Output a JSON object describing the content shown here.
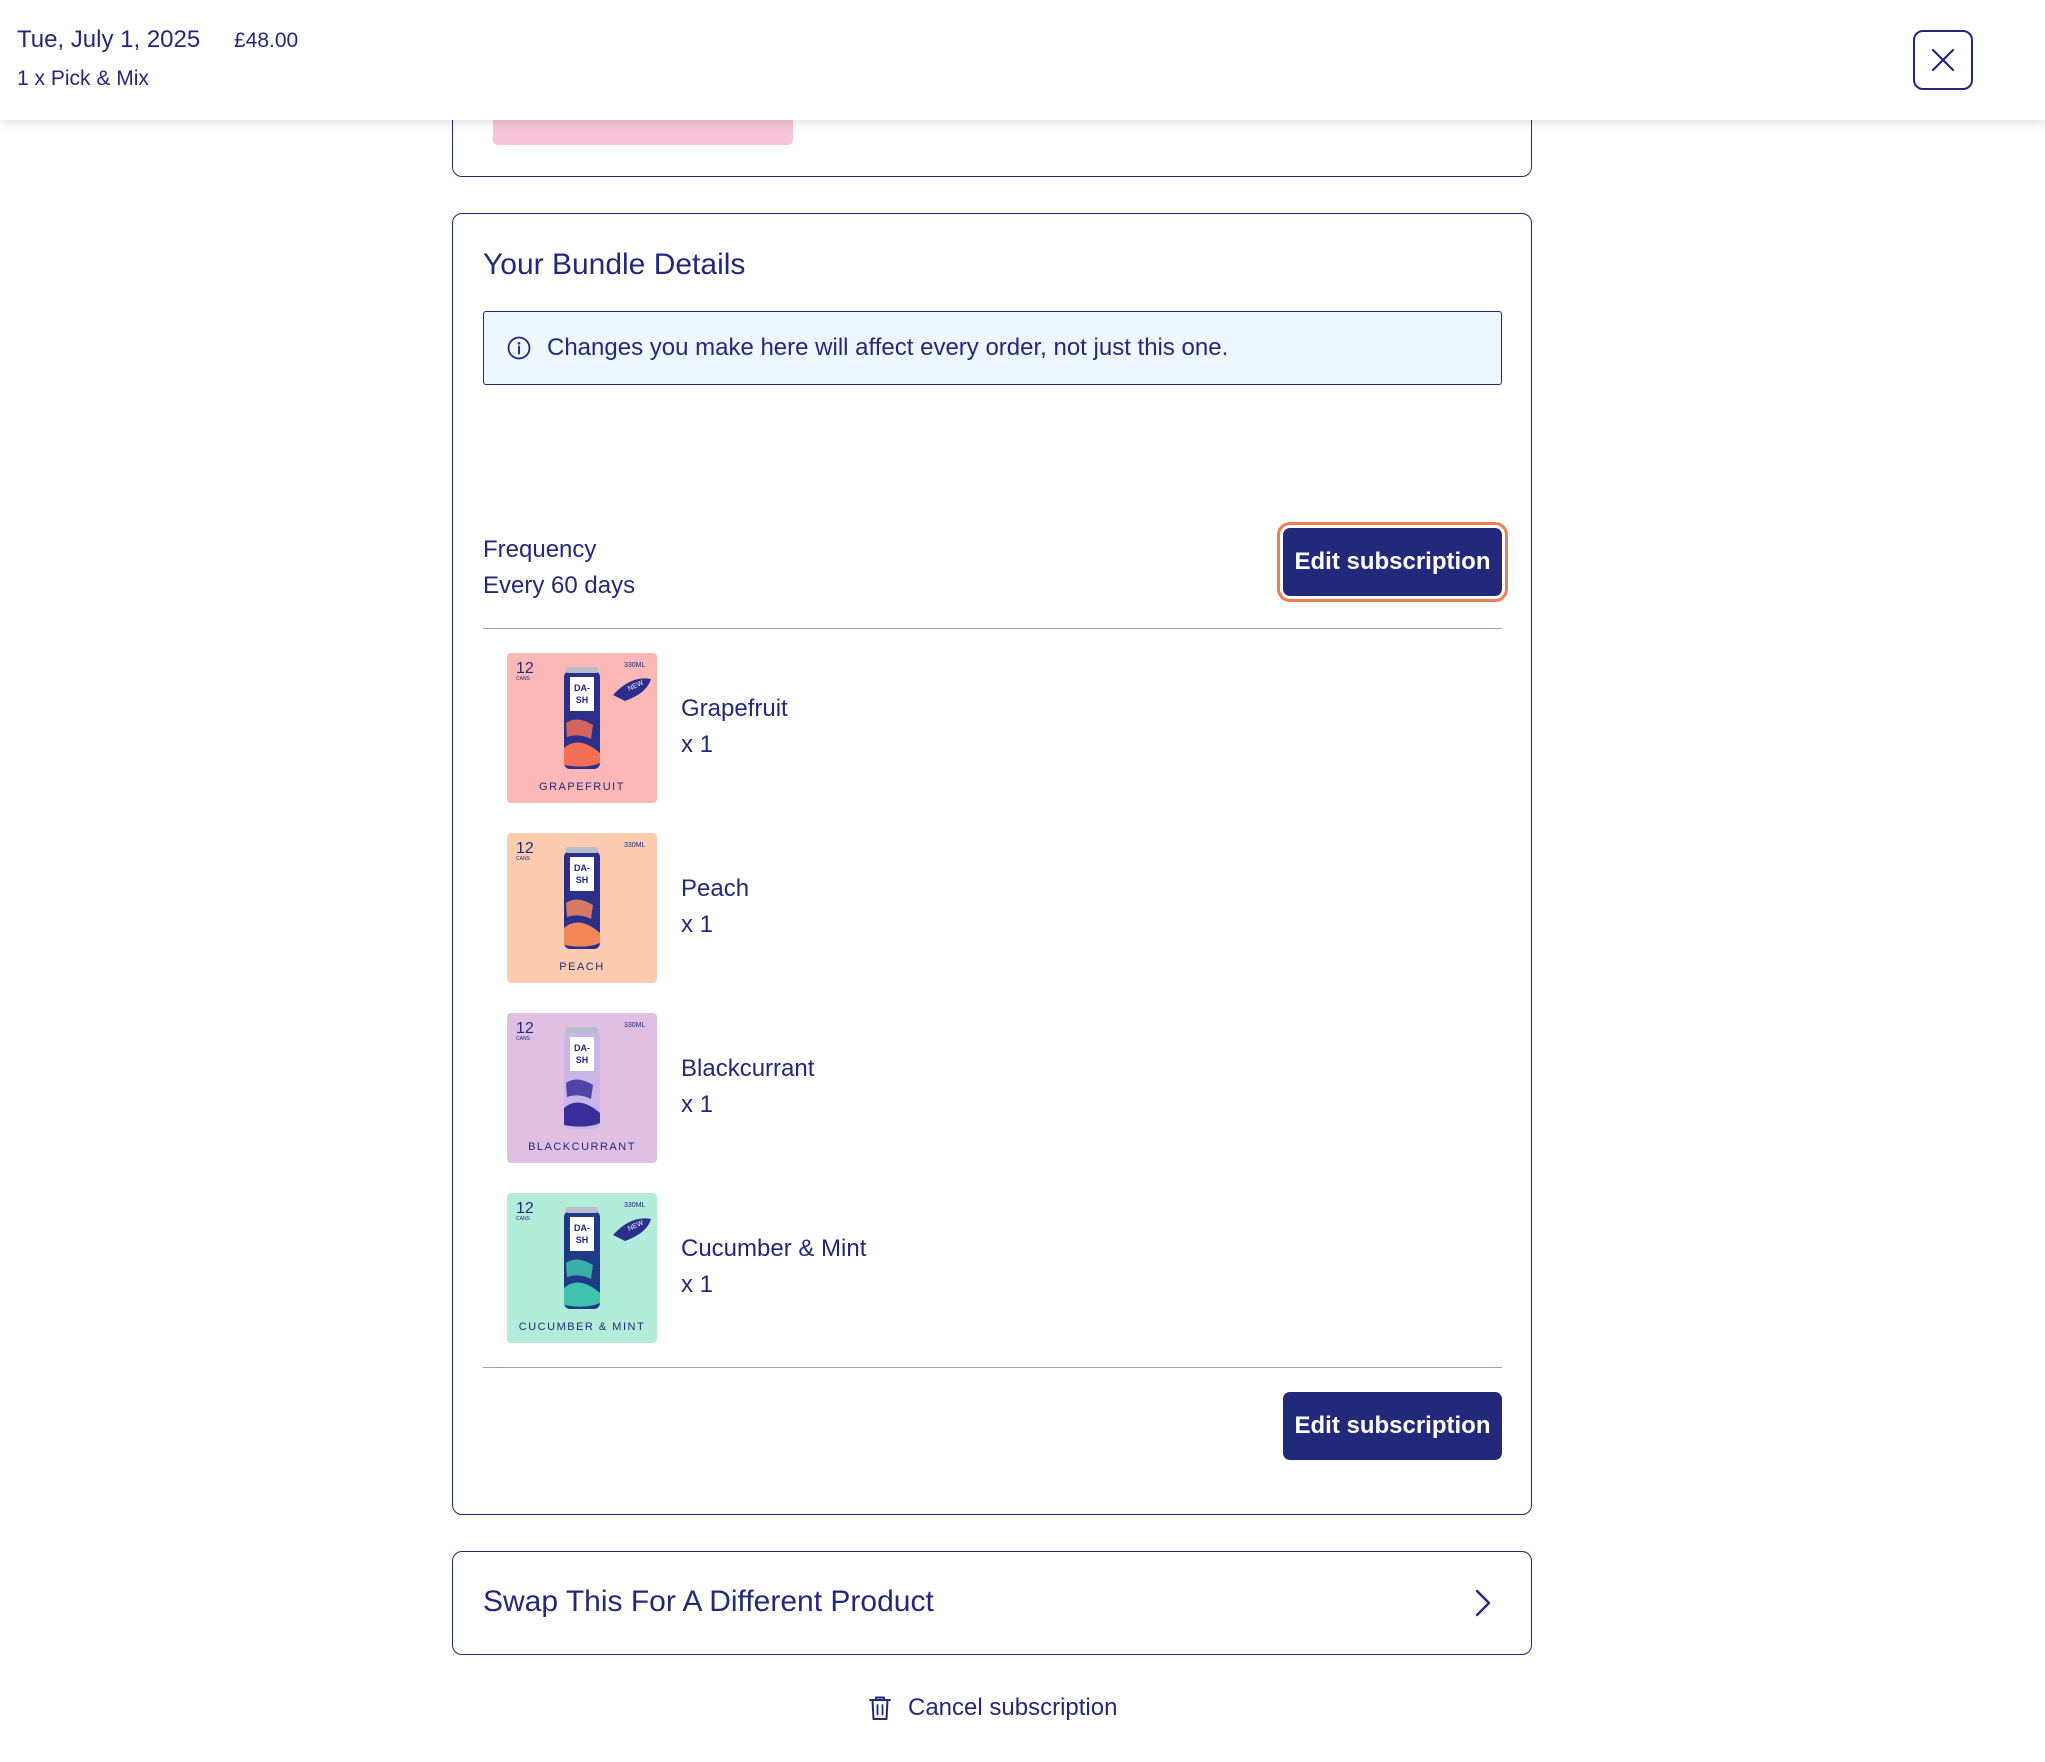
{
  "header": {
    "date": "Tue, July 1, 2025",
    "price": "£48.00",
    "items_summary": "1 x Pick & Mix",
    "close_icon": "close-icon"
  },
  "bundle": {
    "title": "Your Bundle Details",
    "info_icon": "info-icon",
    "info_text": "Changes you make here will affect every order, not just this one.",
    "frequency_label": "Frequency",
    "frequency_value": "Every 60 days",
    "edit_label_top": "Edit subscription",
    "edit_label_bottom": "Edit subscription",
    "products": [
      {
        "name": "Grapefruit",
        "qty": "x 1",
        "pack_label": "GRAPEFRUIT",
        "count": "12",
        "count_unit": "CANS",
        "volume": "330ML",
        "brand": "DA- SH",
        "new_badge": "NEW",
        "bg": "#fbb8b6",
        "can": "#2a2f8c",
        "accent": "#f26e55"
      },
      {
        "name": "Peach",
        "qty": "x 1",
        "pack_label": "PEACH",
        "count": "12",
        "count_unit": "CANS",
        "volume": "330ML",
        "brand": "DA- SH",
        "new_badge": "",
        "bg": "#fcccb1",
        "can": "#2a2f8c",
        "accent": "#f2875a"
      },
      {
        "name": "Blackcurrant",
        "qty": "x 1",
        "pack_label": "BLACKCURRANT",
        "count": "12",
        "count_unit": "CANS",
        "volume": "330ML",
        "brand": "DA- SH",
        "new_badge": "",
        "bg": "#e0bfe2",
        "can": "#c9b6e8",
        "accent": "#3a2f9a"
      },
      {
        "name": "Cucumber & Mint",
        "qty": "x 1",
        "pack_label": "CUCUMBER & MINT",
        "count": "12",
        "count_unit": "CANS",
        "volume": "330ML",
        "brand": "DA- SH",
        "new_badge": "NEW",
        "bg": "#b3ecd9",
        "can": "#1f3a86",
        "accent": "#41c3b0"
      }
    ]
  },
  "swap": {
    "title": "Swap This For A Different Product",
    "chevron_icon": "chevron-right-icon"
  },
  "cancel": {
    "label": "Cancel subscription",
    "icon": "trash-icon"
  },
  "colors": {
    "brand": "#23297a",
    "focus_ring": "#ef7d50",
    "info_bg": "#eef6fe",
    "pink_button": "#f6c5d9"
  }
}
